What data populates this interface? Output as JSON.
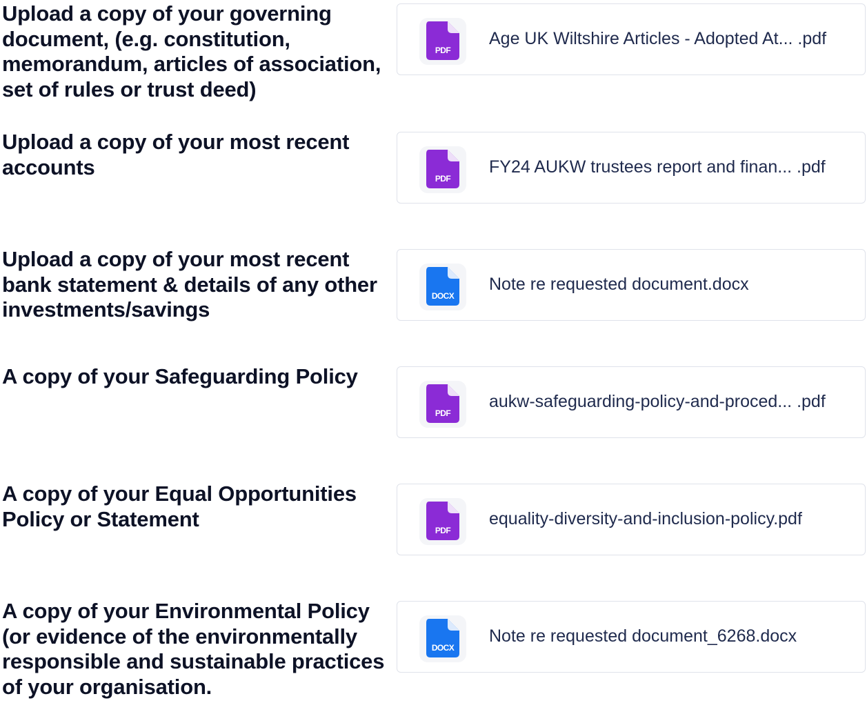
{
  "colors": {
    "pdf_icon": "#8b2bd6",
    "docx_icon": "#1976f0",
    "question_text": "#0d1226",
    "file_name_text": "#1f2a4d",
    "card_border": "#dfe2ea"
  },
  "uploads": [
    {
      "question": "Upload a copy of your governing document, (e.g. constitution, memorandum, articles of association, set of rules or trust deed)",
      "file_type": "PDF",
      "file_icon": "pdf-file-icon",
      "file_name": "Age UK Wiltshire Articles - Adopted At... .pdf"
    },
    {
      "question": "Upload a copy of your most recent accounts",
      "file_type": "PDF",
      "file_icon": "pdf-file-icon",
      "file_name": "FY24 AUKW trustees report and finan... .pdf"
    },
    {
      "question": "Upload a copy of your most recent bank statement & details of any other investments/savings",
      "file_type": "DOCX",
      "file_icon": "docx-file-icon",
      "file_name": "Note re requested document.docx"
    },
    {
      "question": "A copy of your Safeguarding Policy",
      "file_type": "PDF",
      "file_icon": "pdf-file-icon",
      "file_name": "aukw-safeguarding-policy-and-proced... .pdf"
    },
    {
      "question": "A copy of your Equal Opportunities Policy or Statement",
      "file_type": "PDF",
      "file_icon": "pdf-file-icon",
      "file_name": "equality-diversity-and-inclusion-policy.pdf"
    },
    {
      "question": "A copy of your Environmental Policy (or evidence of the environmentally responsible and sustainable practices of your organisation.",
      "file_type": "DOCX",
      "file_icon": "docx-file-icon",
      "file_name": "Note re requested document_6268.docx"
    }
  ]
}
